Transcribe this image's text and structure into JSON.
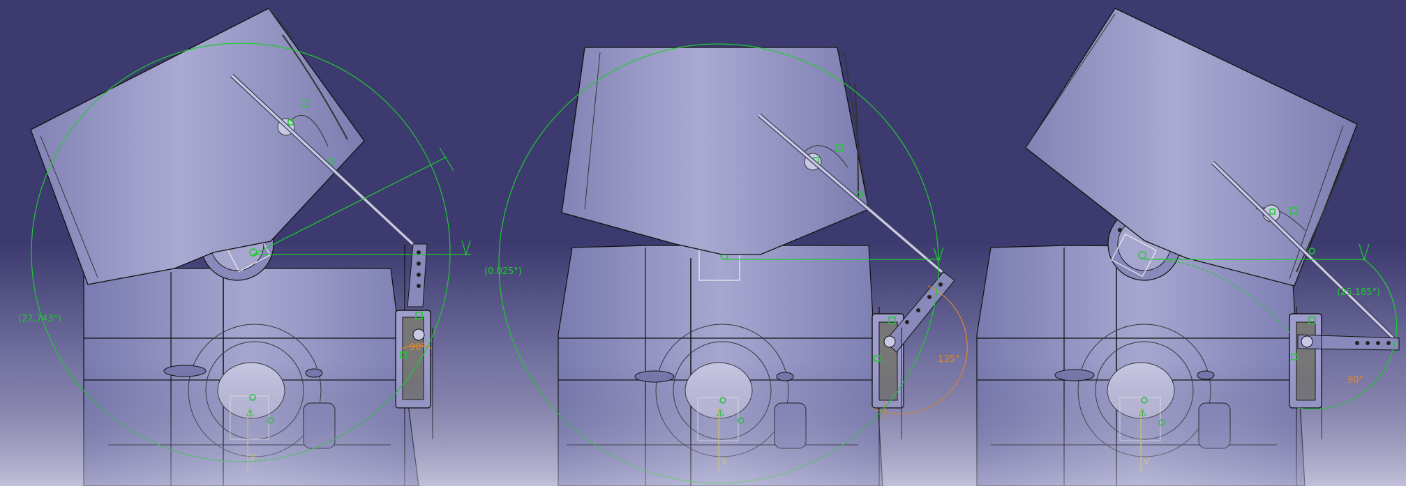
{
  "viewport": {
    "background_top": "#3c3a6e",
    "background_bottom": "#b8b6d2",
    "body_fill": "#9a9ac6",
    "edge_color": "#111122",
    "constraint_color": "#1ecc2e",
    "dimension_color": "#e0892a",
    "axis_color": "#e5d84a"
  },
  "views": [
    {
      "id": "view-left",
      "annotations": {
        "angle_label": "(27.743°)",
        "servo_label": "90°"
      }
    },
    {
      "id": "view-middle",
      "annotations": {
        "angle_label": "(0.025°)",
        "servo_label": "135°"
      }
    },
    {
      "id": "view-right",
      "annotations": {
        "angle_label": "(25.185°)",
        "servo_label": "90°"
      }
    }
  ]
}
